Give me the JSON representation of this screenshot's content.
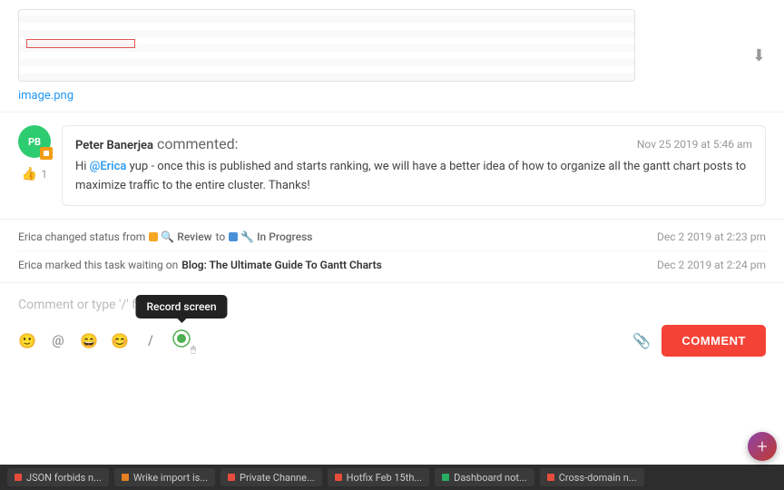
{
  "image": {
    "filename": "image.png",
    "download_label": "⬇"
  },
  "comment": {
    "author": "Peter Banerjea",
    "action": "commented:",
    "timestamp": "Nov 25 2019 at 5:46 am",
    "mention": "@Erica",
    "text_before_mention": "Hi ",
    "text_after_mention": " yup - once this is published and starts ranking, we will have a better idea of how to organize all the gantt chart posts to maximize traffic to the entire cluster. Thanks!",
    "like_count": "1",
    "avatar_initials": "PB"
  },
  "activities": [
    {
      "actor": "Erica",
      "action": "changed status from",
      "from_status": "Review",
      "to_word": "to",
      "to_status": "In Progress",
      "timestamp": "Dec 2 2019 at 2:23 pm"
    },
    {
      "actor": "Erica",
      "action": "marked this task waiting on",
      "link": "Blog: The Ultimate Guide To Gantt Charts",
      "timestamp": "Dec 2 2019 at 2:24 pm"
    }
  ],
  "comment_input": {
    "placeholder": "Comment or type '/' for commands",
    "button_label": "COMMENT",
    "record_tooltip": "Record screen"
  },
  "toolbar_icons": {
    "emoji_person": "☺",
    "at_mention": "@",
    "emoji_smile": "☻",
    "emoji_face": "😊",
    "slash": "/",
    "record_screen": "⏺"
  },
  "taskbar": {
    "items": [
      {
        "label": "JSON forbids n...",
        "color": "#e74c3c"
      },
      {
        "label": "Wrike import is...",
        "color": "#e67e22"
      },
      {
        "label": "Private Channe...",
        "color": "#e74c3c"
      },
      {
        "label": "Hotfix Feb 15th...",
        "color": "#e74c3c"
      },
      {
        "label": "Dashboard not...",
        "color": "#27ae60"
      },
      {
        "label": "Cross-domain n...",
        "color": "#e74c3c"
      }
    ]
  }
}
